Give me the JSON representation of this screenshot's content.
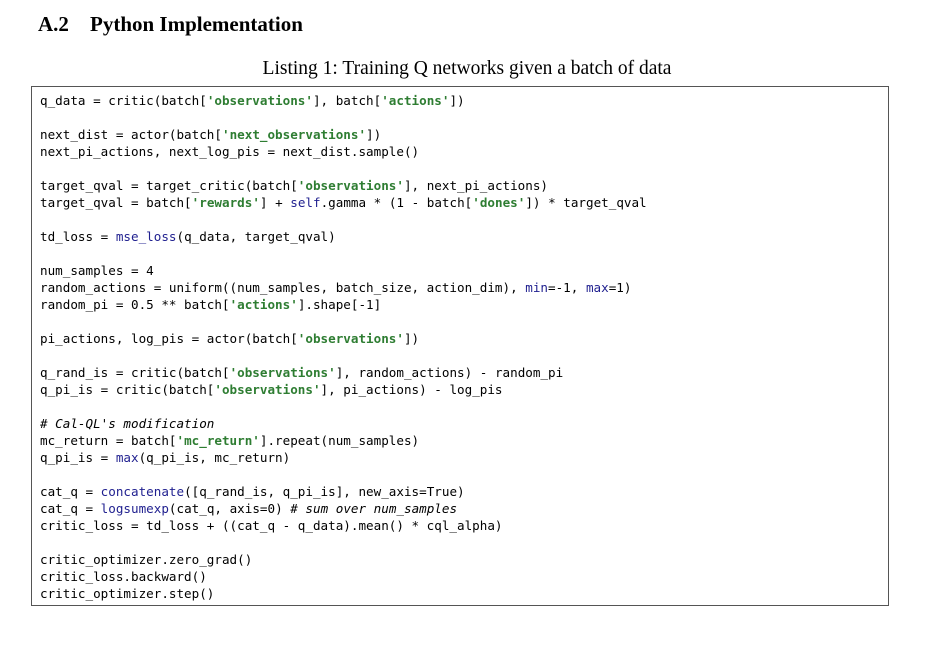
{
  "section": {
    "number": "A.2",
    "title": "Python Implementation"
  },
  "listing": {
    "caption": "Listing 1: Training Q networks given a batch of data"
  },
  "code_lines": [
    [
      {
        "t": "q_data = critic(batch["
      },
      {
        "t": "'observations'",
        "k": "str"
      },
      {
        "t": "], batch["
      },
      {
        "t": "'actions'",
        "k": "str"
      },
      {
        "t": "])"
      }
    ],
    [],
    [
      {
        "t": "next_dist = actor(batch["
      },
      {
        "t": "'next_observations'",
        "k": "str"
      },
      {
        "t": "])"
      }
    ],
    [
      {
        "t": "next_pi_actions, next_log_pis = next_dist.sample()"
      }
    ],
    [],
    [
      {
        "t": "target_qval = target_critic(batch["
      },
      {
        "t": "'observations'",
        "k": "str"
      },
      {
        "t": "], next_pi_actions)"
      }
    ],
    [
      {
        "t": "target_qval = batch["
      },
      {
        "t": "'rewards'",
        "k": "str"
      },
      {
        "t": "] + "
      },
      {
        "t": "self",
        "k": "kw"
      },
      {
        "t": ".gamma * (1 - batch["
      },
      {
        "t": "'dones'",
        "k": "str"
      },
      {
        "t": "]) * target_qval"
      }
    ],
    [],
    [
      {
        "t": "td_loss = "
      },
      {
        "t": "mse_loss",
        "k": "fn"
      },
      {
        "t": "(q_data, target_qval)"
      }
    ],
    [],
    [
      {
        "t": "num_samples = 4"
      }
    ],
    [
      {
        "t": "random_actions = uniform((num_samples, batch_size, action_dim), "
      },
      {
        "t": "min",
        "k": "kw"
      },
      {
        "t": "=-1, "
      },
      {
        "t": "max",
        "k": "kw"
      },
      {
        "t": "=1)"
      }
    ],
    [
      {
        "t": "random_pi = 0.5 ** batch["
      },
      {
        "t": "'actions'",
        "k": "str"
      },
      {
        "t": "].shape[-1]"
      }
    ],
    [],
    [
      {
        "t": "pi_actions, log_pis = actor(batch["
      },
      {
        "t": "'observations'",
        "k": "str"
      },
      {
        "t": "])"
      }
    ],
    [],
    [
      {
        "t": "q_rand_is = critic(batch["
      },
      {
        "t": "'observations'",
        "k": "str"
      },
      {
        "t": "], random_actions) - random_pi"
      }
    ],
    [
      {
        "t": "q_pi_is = critic(batch["
      },
      {
        "t": "'observations'",
        "k": "str"
      },
      {
        "t": "], pi_actions) - log_pis"
      }
    ],
    [],
    [
      {
        "t": "# Cal-QL's modification",
        "k": "comment"
      }
    ],
    [
      {
        "t": "mc_return = batch["
      },
      {
        "t": "'mc_return'",
        "k": "str"
      },
      {
        "t": "].repeat(num_samples)"
      }
    ],
    [
      {
        "t": "q_pi_is = "
      },
      {
        "t": "max",
        "k": "fn"
      },
      {
        "t": "(q_pi_is, mc_return)"
      }
    ],
    [],
    [
      {
        "t": "cat_q = "
      },
      {
        "t": "concatenate",
        "k": "fn"
      },
      {
        "t": "([q_rand_is, q_pi_is], new_axis=True)"
      }
    ],
    [
      {
        "t": "cat_q = "
      },
      {
        "t": "logsumexp",
        "k": "fn"
      },
      {
        "t": "(cat_q, axis=0) "
      },
      {
        "t": "# sum over num_samples",
        "k": "comment"
      }
    ],
    [
      {
        "t": "critic_loss = td_loss + ((cat_q - q_data).mean() * cql_alpha)"
      }
    ],
    [],
    [
      {
        "t": "critic_optimizer.zero_grad()"
      }
    ],
    [
      {
        "t": "critic_loss.backward()"
      }
    ],
    [
      {
        "t": "critic_optimizer.step()"
      }
    ]
  ],
  "colors": {
    "string": "#2e7d32",
    "function": "#1f1f8f",
    "keyword": "#1f1f8f",
    "border": "#555555"
  }
}
